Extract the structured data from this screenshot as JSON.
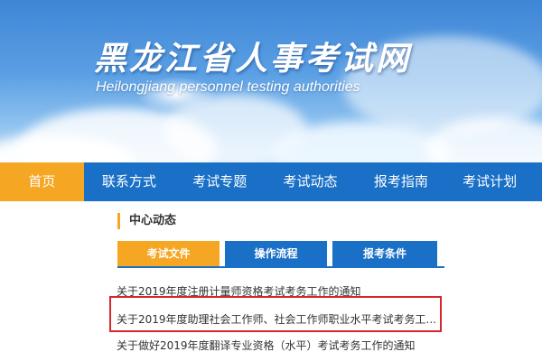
{
  "banner": {
    "title": "黑龙江省人事考试网",
    "subtitle": "Heilongjiang personnel testing authorities"
  },
  "nav": {
    "items": [
      {
        "label": "首页",
        "active": true
      },
      {
        "label": "联系方式",
        "active": false
      },
      {
        "label": "考试专题",
        "active": false
      },
      {
        "label": "考试动态",
        "active": false
      },
      {
        "label": "报考指南",
        "active": false
      },
      {
        "label": "考试计划",
        "active": false
      }
    ]
  },
  "section": {
    "title": "中心动态",
    "tabs": [
      {
        "label": "考试文件",
        "active": true
      },
      {
        "label": "操作流程",
        "active": false
      },
      {
        "label": "报考条件",
        "active": false
      }
    ],
    "news": [
      "关于2019年度注册计量师资格考试考务工作的通知",
      "关于2019年度助理社会工作师、社会工作师职业水平考试考务工...",
      "关于做好2019年度翻译专业资格（水平）考试考务工作的通知"
    ],
    "highlighted_index": 1
  },
  "colors": {
    "nav_blue": "#1a6fc6",
    "accent_orange": "#f5a623",
    "highlight_red": "#d6262d"
  }
}
